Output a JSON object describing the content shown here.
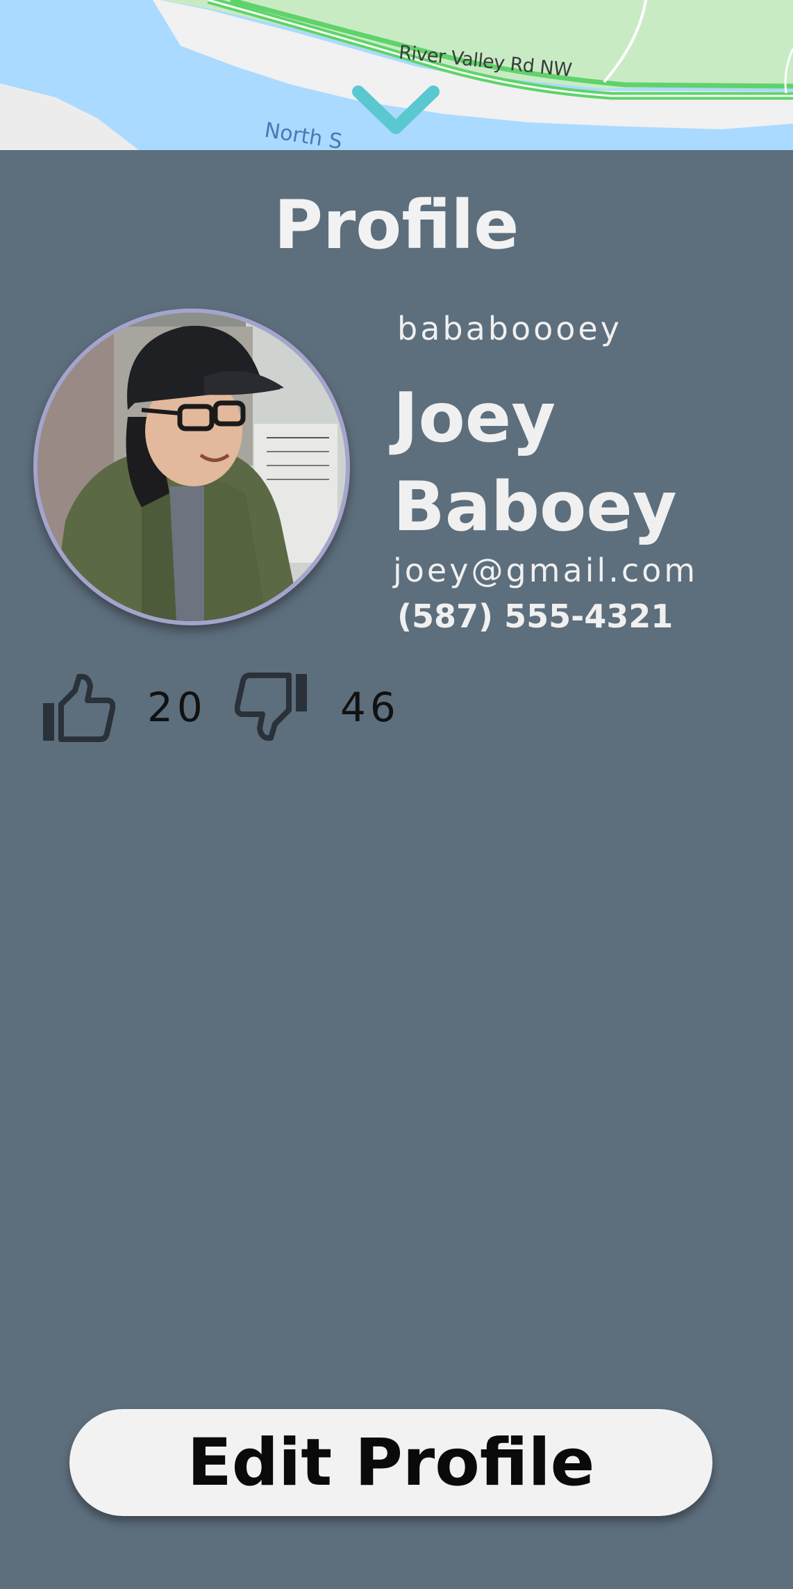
{
  "map": {
    "road_label": "River Valley Rd NW",
    "water_label": "North S",
    "colors": {
      "water": "#aadaff",
      "park": "#c8ebc4",
      "bank": "#f1f1f1",
      "road": "#5fd36a",
      "collapse_chevron": "#5ac8d0"
    },
    "collapse_icon": "chevron-down-icon"
  },
  "profile": {
    "title": "Profile",
    "username": "bababoooey",
    "full_name": "Joey Baboey",
    "email": "joey@gmail.com",
    "phone": "(587) 555-4321",
    "likes": "20",
    "dislikes": "46",
    "like_icon": "thumbs-up-icon",
    "dislike_icon": "thumbs-down-icon",
    "edit_button_label": "Edit Profile"
  },
  "colors": {
    "panel_background": "#5d6e7c",
    "text_light": "#f0f0f0",
    "avatar_border": "#a4a4cc",
    "button_background": "#f2f2f2"
  }
}
